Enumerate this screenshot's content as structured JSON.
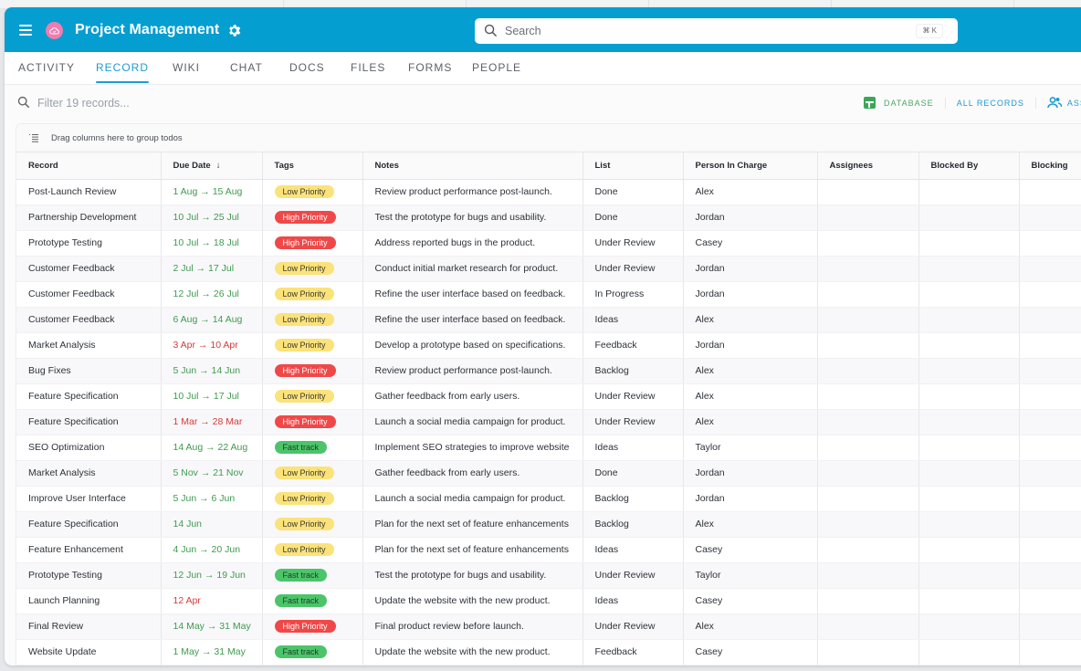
{
  "app": {
    "title": "Project Management",
    "search_placeholder": "Search",
    "search_shortcut": "⌘ K"
  },
  "tabs": [
    {
      "label": "ACTIVITY",
      "active": false
    },
    {
      "label": "RECORD",
      "active": true
    },
    {
      "label": "WIKI",
      "active": false
    },
    {
      "label": "CHAT",
      "active": false
    },
    {
      "label": "DOCS",
      "active": false
    },
    {
      "label": "FILES",
      "active": false
    },
    {
      "label": "FORMS",
      "active": false
    },
    {
      "label": "PEOPLE",
      "active": false
    }
  ],
  "toolbar": {
    "filter_placeholder": "Filter 19 records...",
    "database_label": "DATABASE",
    "all_records_label": "ALL RECORDS",
    "assignees_label": "ASSI"
  },
  "grouping": {
    "hint": "Drag columns here to group todos"
  },
  "table": {
    "columns": [
      "Record",
      "Due Date",
      "Tags",
      "Notes",
      "List",
      "Person In Charge",
      "Assignees",
      "Blocked By",
      "Blocking"
    ],
    "sort_indicator": "↓",
    "rows": [
      {
        "record": "Post-Launch Review",
        "due": "1 Aug → 15 Aug",
        "due_status": "green",
        "tag": "Low Priority",
        "tag_type": "low",
        "notes": "Review product performance post-launch.",
        "list": "Done",
        "person": "Alex"
      },
      {
        "record": "Partnership Development",
        "due": "10 Jul → 25 Jul",
        "due_status": "green",
        "tag": "High Priority",
        "tag_type": "high",
        "notes": "Test the prototype for bugs and usability.",
        "list": "Done",
        "person": "Jordan"
      },
      {
        "record": "Prototype Testing",
        "due": "10 Jul → 18 Jul",
        "due_status": "green",
        "tag": "High Priority",
        "tag_type": "high",
        "notes": "Address reported bugs in the product.",
        "list": "Under Review",
        "person": "Casey"
      },
      {
        "record": "Customer Feedback",
        "due": "2 Jul → 17 Jul",
        "due_status": "green",
        "tag": "Low Priority",
        "tag_type": "low",
        "notes": "Conduct initial market research for product.",
        "list": "Under Review",
        "person": "Jordan"
      },
      {
        "record": "Customer Feedback",
        "due": "12 Jul → 26 Jul",
        "due_status": "green",
        "tag": "Low Priority",
        "tag_type": "low",
        "notes": "Refine the user interface based on feedback.",
        "list": "In Progress",
        "person": "Jordan"
      },
      {
        "record": "Customer Feedback",
        "due": "6 Aug → 14 Aug",
        "due_status": "green",
        "tag": "Low Priority",
        "tag_type": "low",
        "notes": "Refine the user interface based on feedback.",
        "list": "Ideas",
        "person": "Alex"
      },
      {
        "record": "Market Analysis",
        "due": "3 Apr → 10 Apr",
        "due_status": "red",
        "tag": "Low Priority",
        "tag_type": "low",
        "notes": "Develop a prototype based on specifications.",
        "list": "Feedback",
        "person": "Jordan"
      },
      {
        "record": "Bug Fixes",
        "due": "5 Jun → 14 Jun",
        "due_status": "green",
        "tag": "High Priority",
        "tag_type": "high",
        "notes": "Review product performance post-launch.",
        "list": "Backlog",
        "person": "Alex"
      },
      {
        "record": "Feature Specification",
        "due": "10 Jul → 17 Jul",
        "due_status": "green",
        "tag": "Low Priority",
        "tag_type": "low",
        "notes": "Gather feedback from early users.",
        "list": "Under Review",
        "person": "Alex"
      },
      {
        "record": "Feature Specification",
        "due": "1 Mar → 28 Mar",
        "due_status": "red",
        "tag": "High Priority",
        "tag_type": "high",
        "notes": "Launch a social media campaign for product.",
        "list": "Under Review",
        "person": "Alex"
      },
      {
        "record": "SEO Optimization",
        "due": "14 Aug → 22 Aug",
        "due_status": "green",
        "tag": "Fast track",
        "tag_type": "fast",
        "notes": "Implement SEO strategies to improve website",
        "list": "Ideas",
        "person": "Taylor"
      },
      {
        "record": "Market Analysis",
        "due": "5 Nov → 21 Nov",
        "due_status": "green",
        "tag": "Low Priority",
        "tag_type": "low",
        "notes": "Gather feedback from early users.",
        "list": "Done",
        "person": "Jordan"
      },
      {
        "record": "Improve User Interface",
        "due": "5 Jun → 6 Jun",
        "due_status": "green",
        "tag": "Low Priority",
        "tag_type": "low",
        "notes": "Launch a social media campaign for product.",
        "list": "Backlog",
        "person": "Jordan"
      },
      {
        "record": "Feature Specification",
        "due": "14 Jun",
        "due_status": "green",
        "tag": "Low Priority",
        "tag_type": "low",
        "notes": "Plan for the next set of feature enhancements",
        "list": "Backlog",
        "person": "Alex"
      },
      {
        "record": "Feature Enhancement",
        "due": "4 Jun → 20 Jun",
        "due_status": "green",
        "tag": "Low Priority",
        "tag_type": "low",
        "notes": "Plan for the next set of feature enhancements",
        "list": "Ideas",
        "person": "Casey"
      },
      {
        "record": "Prototype Testing",
        "due": "12 Jun → 19 Jun",
        "due_status": "green",
        "tag": "Fast track",
        "tag_type": "fast",
        "notes": "Test the prototype for bugs and usability.",
        "list": "Under Review",
        "person": "Taylor"
      },
      {
        "record": "Launch Planning",
        "due": "12 Apr",
        "due_status": "red",
        "tag": "Fast track",
        "tag_type": "fast",
        "notes": "Update the website with the new product.",
        "list": "Ideas",
        "person": "Casey"
      },
      {
        "record": "Final Review",
        "due": "14 May → 31 May",
        "due_status": "green",
        "tag": "High Priority",
        "tag_type": "high",
        "notes": "Final product review before launch.",
        "list": "Under Review",
        "person": "Alex"
      },
      {
        "record": "Website Update",
        "due": "1 May → 31 May",
        "due_status": "green",
        "tag": "Fast track",
        "tag_type": "fast",
        "notes": "Update the website with the new product.",
        "list": "Feedback",
        "person": "Casey"
      }
    ]
  },
  "colors": {
    "brand": "#059ed1",
    "accent": "#1d9bd1",
    "low_priority": "#fbe27a",
    "high_priority": "#f04848",
    "fast_track": "#4cc46a",
    "date_ok": "#3f9b4e",
    "date_overdue": "#d53a3a"
  }
}
